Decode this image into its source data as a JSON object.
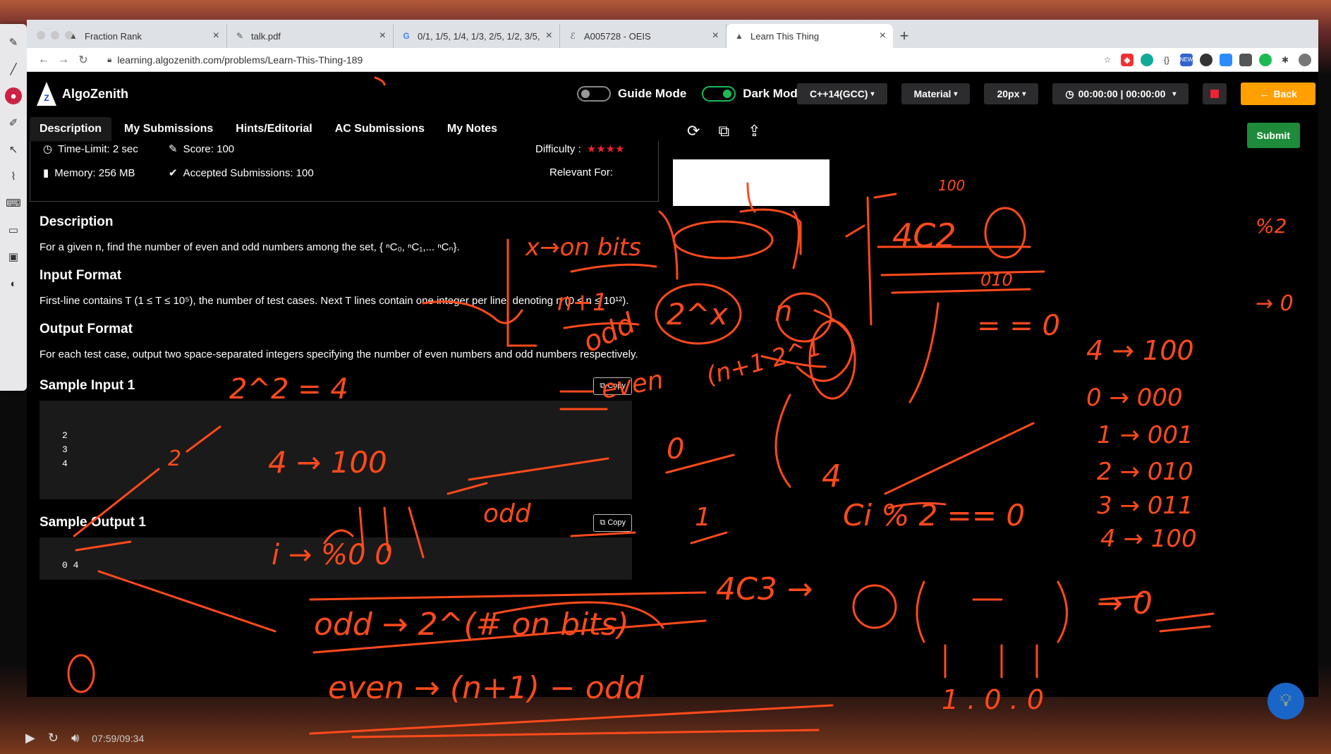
{
  "browser": {
    "tabs": [
      {
        "label": "Fraction Rank",
        "icon": "algozenith-favicon",
        "active": false
      },
      {
        "label": "talk.pdf",
        "icon": "pdf-favicon",
        "active": false
      },
      {
        "label": "0/1, 1/5, 1/4, 1/3, 2/5, 1/2, 3/5,",
        "icon": "google-favicon",
        "active": false
      },
      {
        "label": "A005728 - OEIS",
        "icon": "oeis-favicon",
        "active": false
      },
      {
        "label": "Learn This Thing",
        "icon": "algozenith-favicon",
        "active": true
      }
    ],
    "close_glyph": "×",
    "new_tab_glyph": "+",
    "url": "learning.algozenith.com/problems/Learn-This-Thing-189"
  },
  "app": {
    "brand": "AlgoZenith",
    "logo_letter": "Z",
    "guide_mode_label": "Guide Mode",
    "dark_mode_label": "Dark Mode",
    "language": "C++14(GCC)",
    "theme": "Material",
    "font_size": "20px",
    "timer": "00:00:00 | 00:00:00",
    "back_label": "Back"
  },
  "problem": {
    "tabs": [
      "Description",
      "My Submissions",
      "Hints/Editorial",
      "AC Submissions",
      "My Notes"
    ],
    "time_limit": "Time-Limit: 2 sec",
    "score": "Score: 100",
    "difficulty_label": "Difficulty :",
    "difficulty_stars": 4,
    "memory": "Memory: 256 MB",
    "accepted": "Accepted Submissions: 100",
    "relevant_for": "Relevant For:",
    "description_heading": "Description",
    "description_text": "For a given n, find the number of even and odd numbers among the set, { ⁿC₀, ⁿC₁,... ⁿCₙ}.",
    "input_heading": "Input Format",
    "input_text": "First-line contains T (1 ≤ T ≤ 10⁵), the number of test cases. Next T lines contain one integer per line, denoting n (0 ≤ n ≤ 10¹²).",
    "output_heading": "Output Format",
    "output_text": "For each test case, output two space-separated integers specifying the number of even numbers and odd numbers respectively.",
    "sample_input_heading": "Sample Input 1",
    "sample_input_lines": [
      "2",
      "3",
      "4"
    ],
    "sample_output_heading": "Sample Output 1",
    "sample_output_lines": [
      "0 4"
    ],
    "copy_label": "Copy"
  },
  "editor": {
    "submit_label": "Submit"
  },
  "video": {
    "time": "07:59/09:34"
  },
  "ink": {
    "color": "#ff4a1c",
    "texts": [
      "x→on bits",
      "n+1",
      "odd",
      "even",
      "2^x",
      "n",
      "2^2 = 4",
      "2",
      "4 → 100",
      "odd",
      "i → %0 0",
      "odd → 2^(# on bits)",
      "even → (n+1) − odd",
      "4C2",
      "= = 0",
      "4 → 100",
      "0 → 000",
      "1 → 001",
      "2 → 010",
      "3 → 011",
      "4 → 100",
      "4",
      "Ci % 2 == 0",
      "4C3 →",
      "→ 0",
      "1 . 0 . 0",
      "0",
      "1",
      "%2",
      "→ 0",
      "100",
      "010",
      "(n+1 2^1",
      "3"
    ]
  }
}
